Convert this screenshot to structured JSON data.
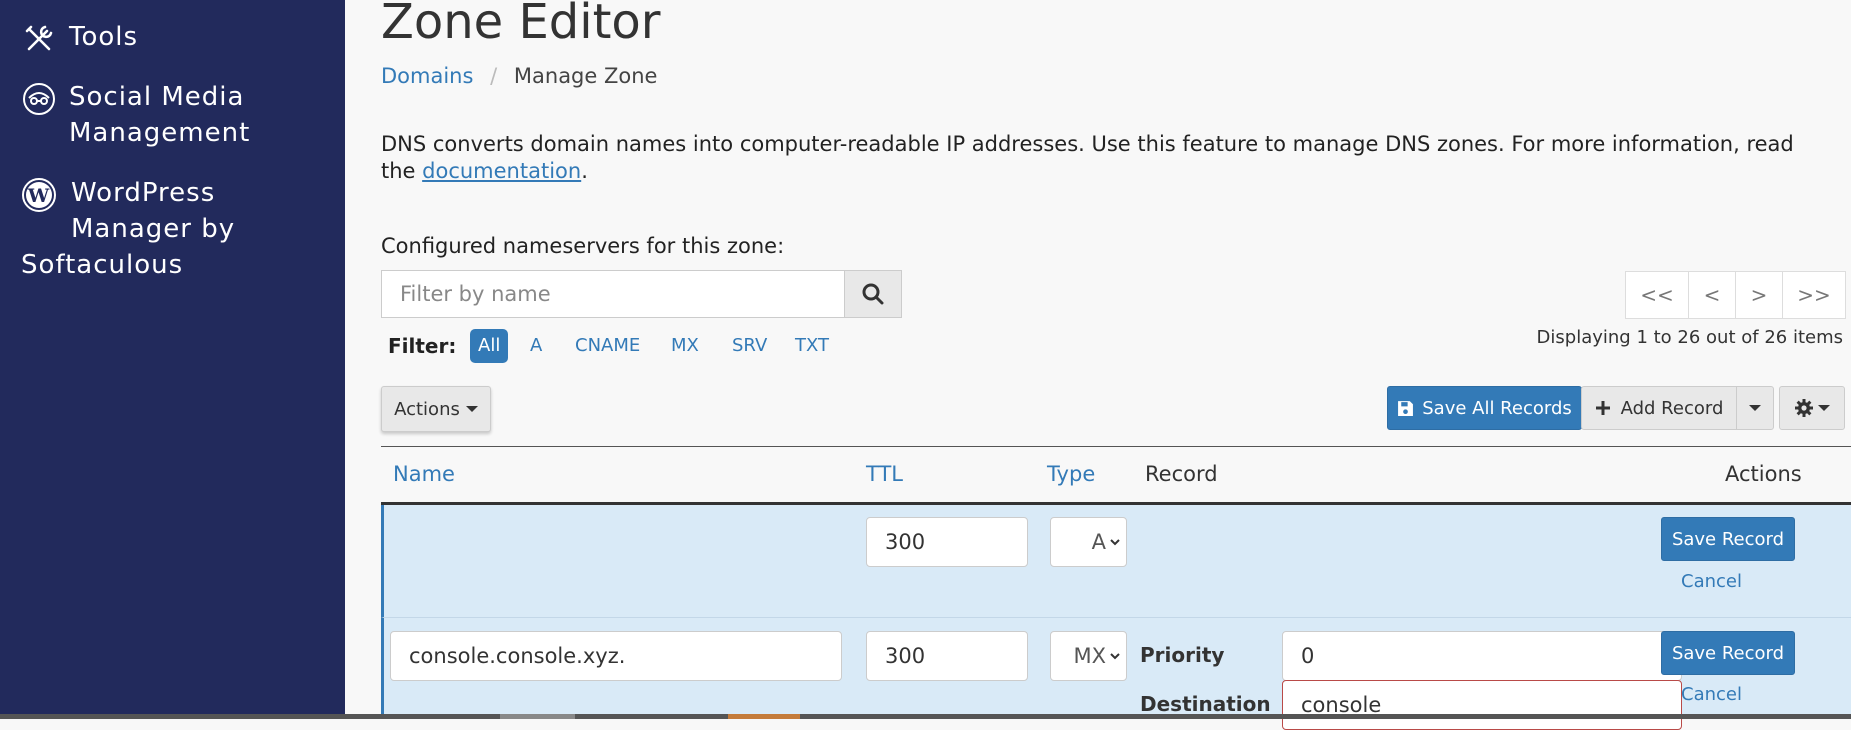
{
  "sidebar": {
    "items": [
      {
        "label_lines": [
          "Tools"
        ],
        "icon": "tools-icon"
      },
      {
        "label_lines": [
          "Social Media",
          "Management"
        ],
        "icon": "social-media-icon"
      },
      {
        "label_lines": [
          "WordPress",
          "Manager by",
          "Softaculous"
        ],
        "icon": "wordpress-icon"
      }
    ]
  },
  "page": {
    "title": "Zone Editor",
    "breadcrumb": {
      "parent": "Domains",
      "separator": "/",
      "current": "Manage Zone"
    },
    "description": "DNS converts domain names into computer-readable IP addresses. Use this feature to manage DNS zones. For more information, read the ",
    "description_link": "documentation",
    "description_end": "."
  },
  "nameservers": {
    "label": "Configured nameservers for this zone:"
  },
  "search": {
    "placeholder": "Filter by name",
    "icon": "search-icon"
  },
  "filter": {
    "label": "Filter:",
    "options": [
      "All",
      "A",
      "CNAME",
      "MX",
      "SRV",
      "TXT"
    ],
    "active": "All"
  },
  "pagination": {
    "first": "<<",
    "prev": "<",
    "next": ">",
    "last": ">>",
    "status": "Displaying 1 to 26 out of 26 items"
  },
  "toolbar": {
    "actions_label": "Actions",
    "save_all_label": "Save All Records",
    "add_record_label": "Add Record",
    "settings_icon": "gear-icon"
  },
  "table": {
    "columns": {
      "name": "Name",
      "ttl": "TTL",
      "type": "Type",
      "record": "Record",
      "actions": "Actions"
    },
    "rows": [
      {
        "name": "",
        "ttl": "300",
        "type": "A",
        "save": "Save Record",
        "cancel": "Cancel"
      },
      {
        "name": "console.console.xyz.",
        "ttl": "300",
        "type": "MX",
        "priority_label": "Priority",
        "priority": "0",
        "destination_label": "Destination",
        "destination": "console",
        "save": "Save Record",
        "cancel": "Cancel"
      }
    ]
  },
  "colors": {
    "sidebar": "#222a5c",
    "accent": "#337ab7",
    "row_edit": "#d9eaf7"
  }
}
